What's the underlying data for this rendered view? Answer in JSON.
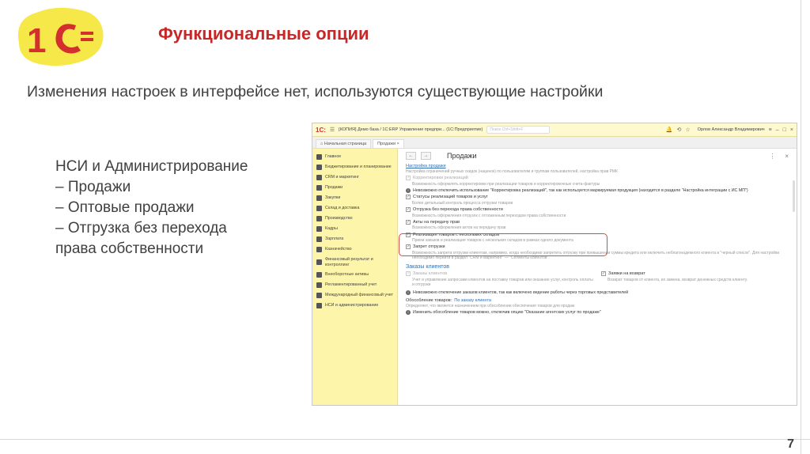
{
  "slide": {
    "title": "Функциональные опции",
    "subtitle": "Изменения настроек в интерфейсе нет, используются существующие настройки",
    "bullets": [
      "НСИ и Администрирование",
      "– Продажи",
      "– Оптовые продажи",
      "– Отгрузка без перехода",
      "права собственности"
    ],
    "page_number": "7",
    "logo_text": "1С"
  },
  "app": {
    "logo": "1С:",
    "title": "[КОПИЯ] Демо база / 1С:ERP Управление предпри... (1С:Предприятие)",
    "search_placeholder": "Поиск Ctrl+Shift+F",
    "user": "Орлов Александр Владимирович",
    "tabs": [
      "Начальная страница",
      "Продажи"
    ],
    "tab_close": "×",
    "page_title": "Продажи",
    "sidebar": [
      "Главное",
      "Бюджетирование и планирование",
      "CRM и маркетинг",
      "Продажи",
      "Закупки",
      "Склад и доставка",
      "Производство",
      "Кадры",
      "Зарплата",
      "Казначейство",
      "Финансовый результат и контроллинг",
      "Внеоборотные активы",
      "Регламентированный учет",
      "Международный финансовый учет",
      "НСИ и администрирование"
    ],
    "content": {
      "section_link": "Настройка продажи",
      "section_desc": "Настройка ограничений ручных скидок (наценок) по пользователям и группам пользователей, настройка прав РМК",
      "opt1": "Корректировки реализаций",
      "opt1_desc": "Возможность оформлять корректировки при реализации товаров и корректировочные счета-фактуры",
      "info1": "Невозможно отключить использование \"Корректировка реализаций\", так как используется маркируемая продукция (находится в разделе \"Настройка интеграции с ИС МП\")",
      "opt2": "Статусы реализаций товаров и услуг",
      "opt2_desc": "Более детальный контроль процесса отгрузки товаров",
      "opt3": "Отгрузка без перехода права собственности",
      "opt3_desc": "Возможность оформления отгрузок с отложенным переходом права собственности",
      "opt4": "Акты на передачу прав",
      "opt4_desc": "Возможность оформления актов на передачу прав",
      "opt5": "Реализация товаров с нескольких складов",
      "opt5_desc": "Прием заказов и реализация товаров с нескольких складов в рамках одного документа",
      "opt6": "Запрет отгрузки",
      "opt6_desc": "Возможность запрета отгрузки клиентам, например, когда необходимо запретить отгрузку при превышении суммы кредита или включить неблагонадежного клиента в \"черный список\". Для настройки необходимо перейти в раздел \"CRM и маркетинг\" — \"Сегменты клиентов\".",
      "section2": "Заказы клиентов",
      "opt7": "Заказы клиентов",
      "opt7_desc": "Учет и управление запросами клиентов на поставку товаров или оказание услуг, контроль оплаты и отгрузки",
      "opt8": "Заявки на возврат",
      "opt8_desc": "Возврат товаров от клиента, их замена, возврат денежных средств клиенту.",
      "info2": "Невозможно отключение заказов клиентов, так как включено ведение работы через торговых представителей",
      "field_label": "Обособление товаров:",
      "field_value": "По заказу клиента",
      "field_desc": "Определяет, что является назначением при обособлении обеспечения товаров для продаж",
      "info3": "Изменить обособление товаров можно, отключив опцию \"Оказание агентских услуг по продаже\""
    }
  },
  "colors": {
    "title_red": "#c62828",
    "logo_yellow": "#f7e84a",
    "logo_red": "#d32f2f",
    "sidebar_yellow": "#fdf5a9",
    "highlight": "#d84a3a"
  }
}
